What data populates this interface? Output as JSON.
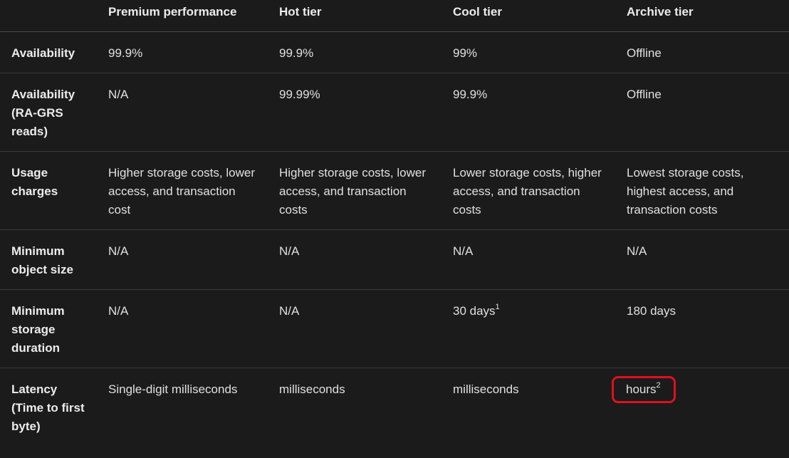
{
  "columns": {
    "corner": "",
    "premium": "Premium performance",
    "hot": "Hot tier",
    "cool": "Cool tier",
    "archive": "Archive tier"
  },
  "rows": [
    {
      "label": "Availability",
      "premium": "99.9%",
      "hot": "99.9%",
      "cool": "99%",
      "archive": "Offline"
    },
    {
      "label": "Availability (RA-GRS reads)",
      "premium": "N/A",
      "hot": "99.99%",
      "cool": "99.9%",
      "archive": "Offline"
    },
    {
      "label": "Usage charges",
      "premium": "Higher storage costs, lower access, and transaction cost",
      "hot": "Higher storage costs, lower access, and transaction costs",
      "cool": "Lower storage costs, higher access, and transaction costs",
      "archive": "Lowest storage costs, highest access, and transaction costs"
    },
    {
      "label": "Minimum object size",
      "premium": "N/A",
      "hot": "N/A",
      "cool": "N/A",
      "archive": "N/A"
    },
    {
      "label": "Minimum storage duration",
      "premium": "N/A",
      "hot": "N/A",
      "cool": "30 days",
      "cool_footnote": "1",
      "archive": "180 days"
    },
    {
      "label": "Latency (Time to first byte)",
      "premium": "Single-digit milliseconds",
      "hot": "milliseconds",
      "cool": "milliseconds",
      "archive": "hours",
      "archive_footnote": "2"
    }
  ],
  "colors": {
    "background": "#1b1b1b",
    "text": "#e6e6e6",
    "divider": "#3a3a3a",
    "highlight_outline": "#e0101e"
  }
}
